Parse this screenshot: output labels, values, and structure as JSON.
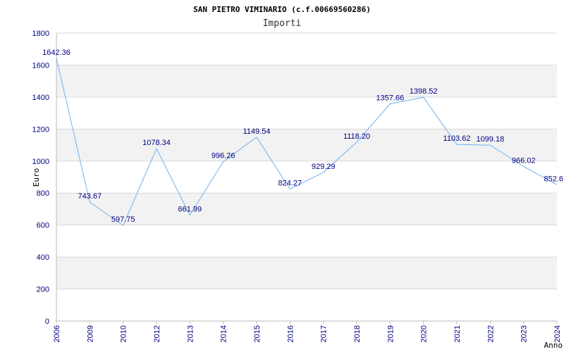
{
  "chart_data": {
    "type": "line",
    "title": "SAN PIETRO VIMINARIO (c.f.00669560286)",
    "subtitle": "Importi",
    "ylabel": "Euro",
    "xlabel": "Anno",
    "ylim": [
      0,
      1800
    ],
    "yticks": [
      0,
      200,
      400,
      600,
      800,
      1000,
      1200,
      1400,
      1600,
      1800
    ],
    "categories": [
      "2006",
      "2009",
      "2010",
      "2012",
      "2013",
      "2014",
      "2015",
      "2016",
      "2017",
      "2018",
      "2019",
      "2020",
      "2021",
      "2022",
      "2023",
      "2024"
    ],
    "values": [
      1642.36,
      743.67,
      597.75,
      1078.34,
      661.99,
      996.26,
      1149.54,
      824.27,
      929.29,
      1118.2,
      1357.66,
      1398.52,
      1103.62,
      1099.18,
      966.02,
      852.6
    ],
    "value_labels": [
      "1642.36",
      "743.67",
      "597.75",
      "1078.34",
      "661.99",
      "996.26",
      "1149.54",
      "824.27",
      "929.29",
      "1118.20",
      "1357.66",
      "1398.52",
      "1103.62",
      "1099.18",
      "966.02",
      "852.6"
    ],
    "grid": true,
    "colors": {
      "line": "#6fb2f0",
      "band": "#f2f2f2",
      "gridline": "#d9d9d9",
      "axis": "#bbbbbb",
      "tick_text": "#000080",
      "label_text": "#000080"
    }
  }
}
